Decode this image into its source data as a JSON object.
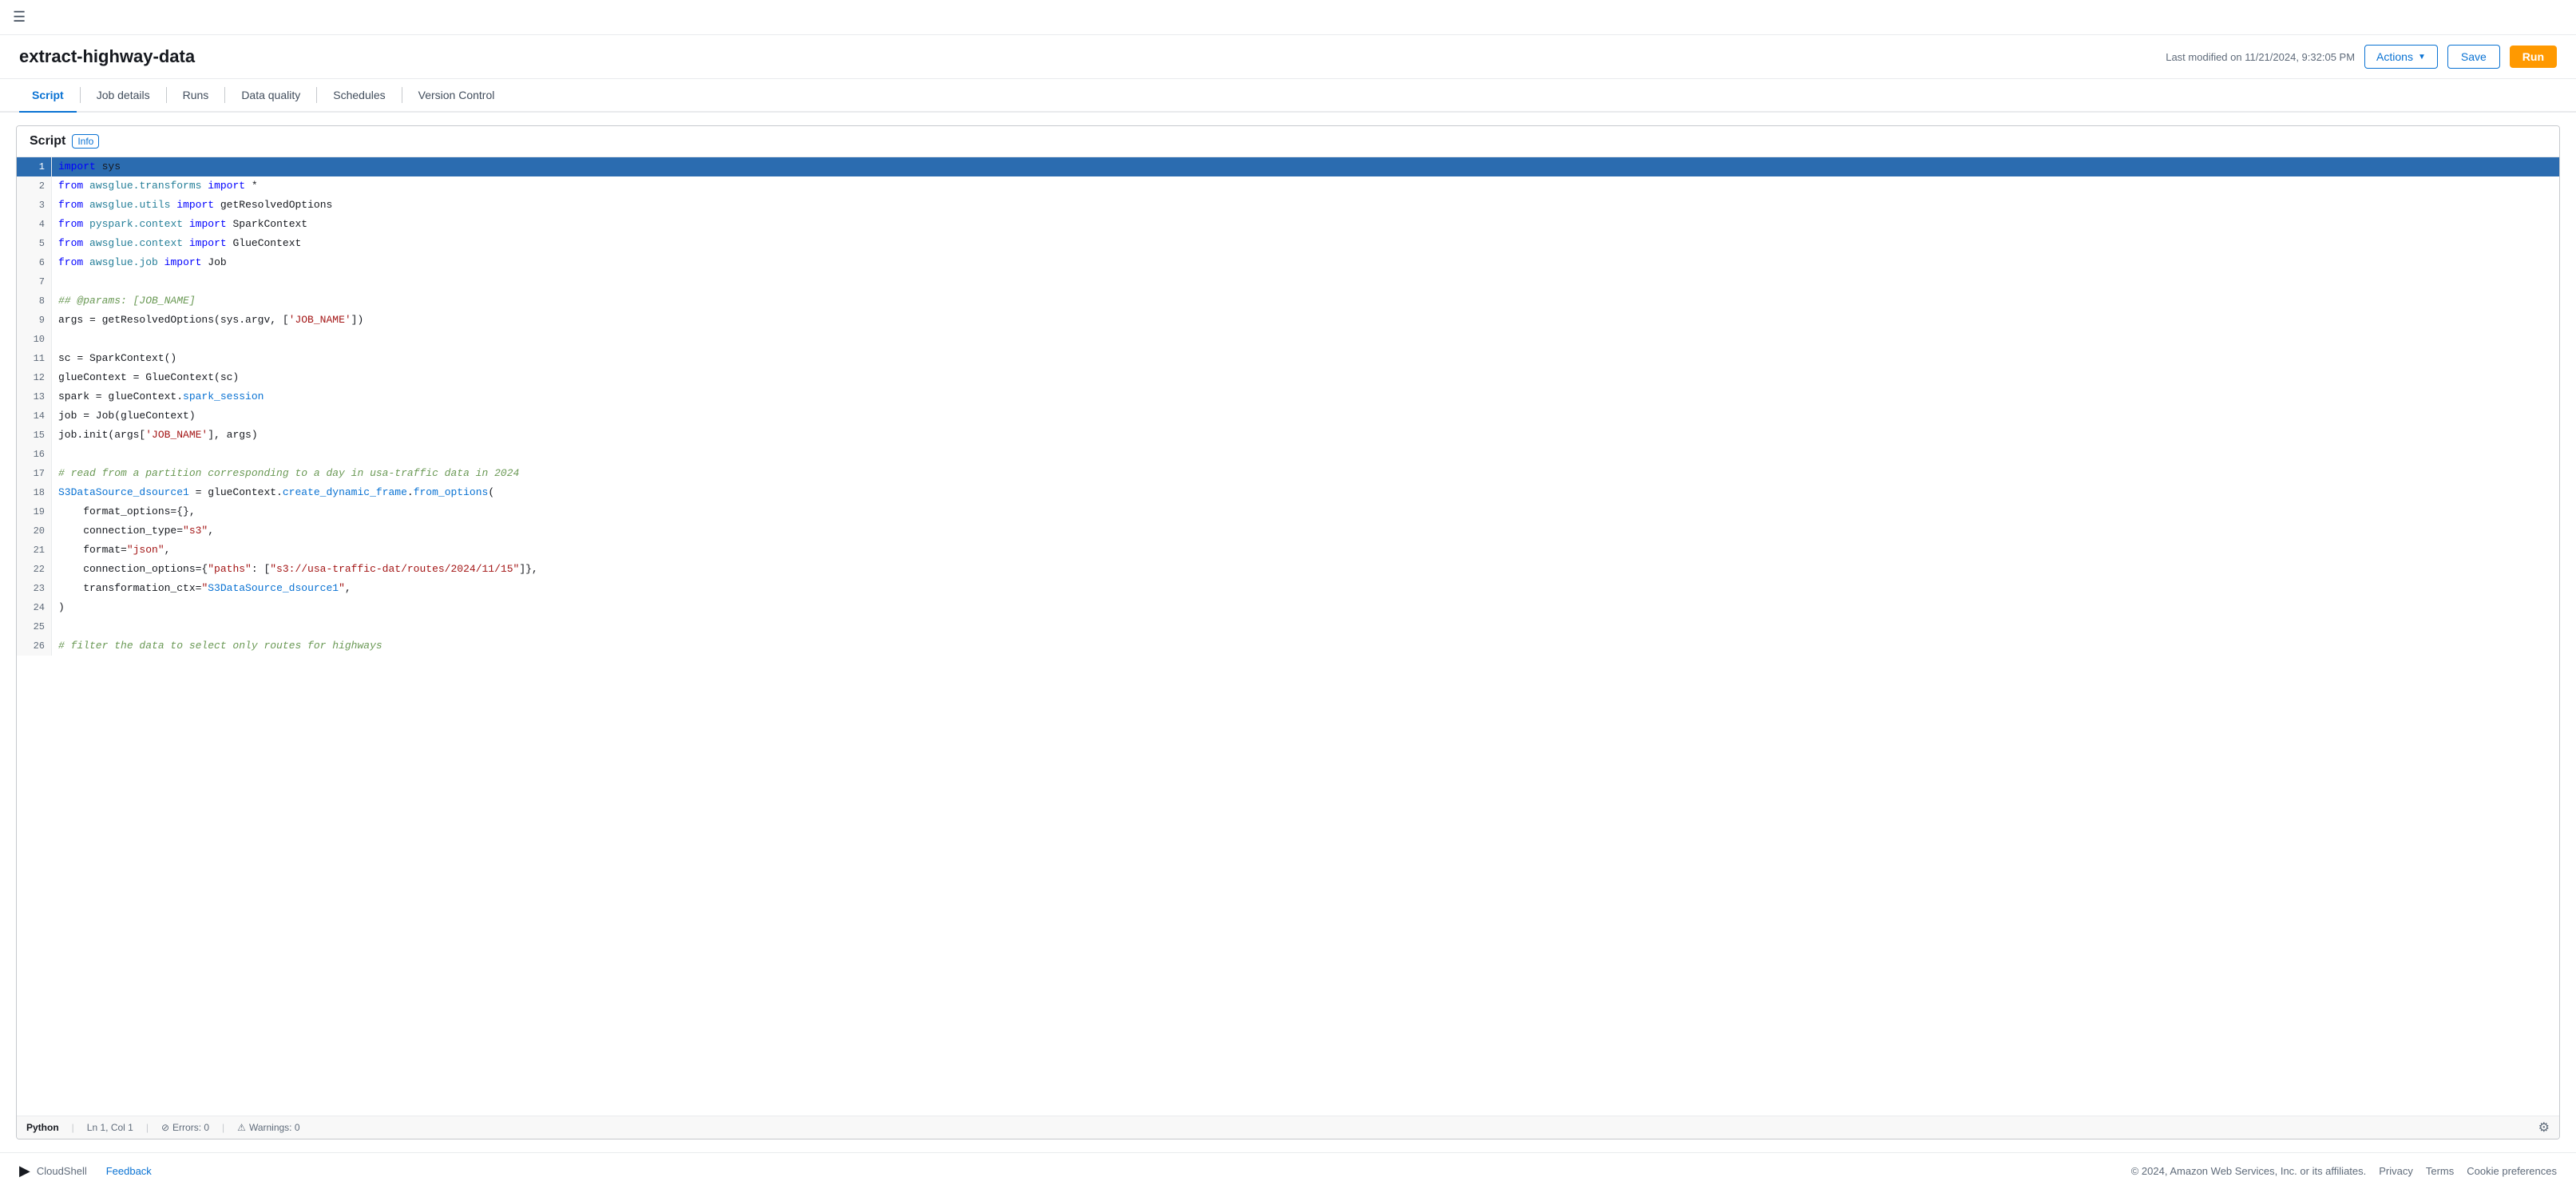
{
  "topbar": {
    "hamburger": "☰"
  },
  "header": {
    "title": "extract-highway-data",
    "last_modified": "Last modified on 11/21/2024, 9:32:05 PM",
    "actions_label": "Actions",
    "save_label": "Save",
    "run_label": "Run"
  },
  "tabs": [
    {
      "id": "script",
      "label": "Script",
      "active": true
    },
    {
      "id": "job-details",
      "label": "Job details",
      "active": false
    },
    {
      "id": "runs",
      "label": "Runs",
      "active": false
    },
    {
      "id": "data-quality",
      "label": "Data quality",
      "active": false
    },
    {
      "id": "schedules",
      "label": "Schedules",
      "active": false
    },
    {
      "id": "version-control",
      "label": "Version Control",
      "active": false
    }
  ],
  "script_panel": {
    "title": "Script",
    "info_label": "Info"
  },
  "status_bar": {
    "language": "Python",
    "position": "Ln 1, Col 1",
    "errors_label": "Errors: 0",
    "warnings_label": "Warnings: 0"
  },
  "footer": {
    "cloudshell_label": "CloudShell",
    "feedback_label": "Feedback",
    "copyright": "© 2024, Amazon Web Services, Inc. or its affiliates.",
    "privacy_label": "Privacy",
    "terms_label": "Terms",
    "cookie_label": "Cookie preferences"
  },
  "code_lines": [
    {
      "num": 1,
      "active": true,
      "content": "import sys"
    },
    {
      "num": 2,
      "active": false,
      "content": "from awsglue.transforms import *"
    },
    {
      "num": 3,
      "active": false,
      "content": "from awsglue.utils import getResolvedOptions"
    },
    {
      "num": 4,
      "active": false,
      "content": "from pyspark.context import SparkContext"
    },
    {
      "num": 5,
      "active": false,
      "content": "from awsglue.context import GlueContext"
    },
    {
      "num": 6,
      "active": false,
      "content": "from awsglue.job import Job"
    },
    {
      "num": 7,
      "active": false,
      "content": ""
    },
    {
      "num": 8,
      "active": false,
      "content": "## @params: [JOB_NAME]"
    },
    {
      "num": 9,
      "active": false,
      "content": "args = getResolvedOptions(sys.argv, ['JOB_NAME'])"
    },
    {
      "num": 10,
      "active": false,
      "content": ""
    },
    {
      "num": 11,
      "active": false,
      "content": "sc = SparkContext()"
    },
    {
      "num": 12,
      "active": false,
      "content": "glueContext = GlueContext(sc)"
    },
    {
      "num": 13,
      "active": false,
      "content": "spark = glueContext.spark_session"
    },
    {
      "num": 14,
      "active": false,
      "content": "job = Job(glueContext)"
    },
    {
      "num": 15,
      "active": false,
      "content": "job.init(args['JOB_NAME'], args)"
    },
    {
      "num": 16,
      "active": false,
      "content": ""
    },
    {
      "num": 17,
      "active": false,
      "content": "# read from a partition corresponding to a day in usa-traffic data in 2024"
    },
    {
      "num": 18,
      "active": false,
      "content": "S3DataSource_dsource1 = glueContext.create_dynamic_frame.from_options("
    },
    {
      "num": 19,
      "active": false,
      "content": "    format_options={},"
    },
    {
      "num": 20,
      "active": false,
      "content": "    connection_type=\"s3\","
    },
    {
      "num": 21,
      "active": false,
      "content": "    format=\"json\","
    },
    {
      "num": 22,
      "active": false,
      "content": "    connection_options={\"paths\": [\"s3://usa-traffic-dat/routes/2024/11/15\"]},"
    },
    {
      "num": 23,
      "active": false,
      "content": "    transformation_ctx=\"S3DataSource_dsource1\","
    },
    {
      "num": 24,
      "active": false,
      "content": ")"
    },
    {
      "num": 25,
      "active": false,
      "content": ""
    },
    {
      "num": 26,
      "active": false,
      "content": "# filter the data to select only routes for highways"
    }
  ]
}
